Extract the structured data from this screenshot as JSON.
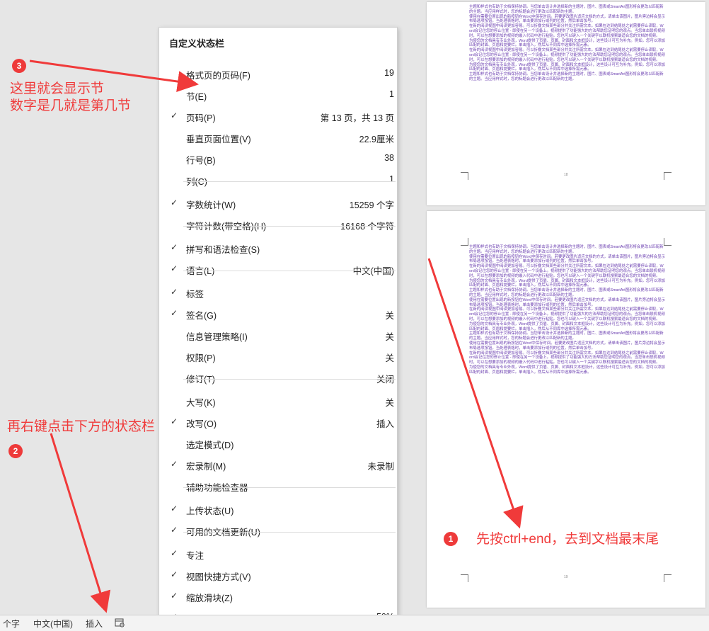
{
  "menu": {
    "title": "自定义状态栏",
    "items": [
      {
        "label": "格式页的页码(F)",
        "value": "19",
        "checked": false
      },
      {
        "label": "节(E)",
        "value": "1",
        "checked": false
      },
      {
        "label": "页码(P)",
        "value": "第 13 页，共 13 页",
        "checked": true
      },
      {
        "label": "垂直页面位置(V)",
        "value": "22.9厘米",
        "checked": false
      },
      {
        "label": "行号(B)",
        "value": "38",
        "checked": false
      },
      {
        "label": "列(C)",
        "value": "1",
        "checked": false
      },
      {
        "label": "字数统计(W)",
        "value": "15259 个字",
        "checked": true
      },
      {
        "label": "字符计数(带空格)(H)",
        "value": "16168 个字符",
        "checked": false
      },
      {
        "label": "拼写和语法检查(S)",
        "value": "",
        "checked": true
      },
      {
        "label": "语言(L)",
        "value": "中文(中国)",
        "checked": true
      },
      {
        "label": "标签",
        "value": "",
        "checked": true
      },
      {
        "label": "签名(G)",
        "value": "关",
        "checked": true
      },
      {
        "label": "信息管理策略(I)",
        "value": "关",
        "checked": false
      },
      {
        "label": "权限(P)",
        "value": "关",
        "checked": false
      },
      {
        "label": "修订(T)",
        "value": "关闭",
        "checked": false
      },
      {
        "label": "大写(K)",
        "value": "关",
        "checked": false
      },
      {
        "label": "改写(O)",
        "value": "插入",
        "checked": true
      },
      {
        "label": "选定模式(D)",
        "value": "",
        "checked": false
      },
      {
        "label": "宏录制(M)",
        "value": "未录制",
        "checked": true
      },
      {
        "label": "辅助功能检查器",
        "value": "",
        "checked": false
      },
      {
        "label": "上传状态(U)",
        "value": "",
        "checked": true
      },
      {
        "label": "可用的文档更新(U)",
        "value": "",
        "checked": true
      },
      {
        "label": "专注",
        "value": "",
        "checked": true
      },
      {
        "label": "视图快捷方式(V)",
        "value": "",
        "checked": true
      },
      {
        "label": "缩放滑块(Z)",
        "value": "",
        "checked": true
      },
      {
        "label": "缩放(Z)",
        "value": "50%",
        "checked": true
      }
    ]
  },
  "status_bar": {
    "word_count": "个字",
    "language": "中文(中国)",
    "mode": "插入"
  },
  "annotations": {
    "step1_number": "1",
    "step1_text": "先按ctrl+end，去到文档最末尾",
    "step2_number": "2",
    "step2_text": "再右键点击下方的状态栏",
    "step3_number": "3",
    "step3_line1": "这里就会显示节",
    "step3_line2": "数字是几就是第几节"
  },
  "document": {
    "page_top_number": "18",
    "page_bottom_number": "19",
    "page_top_paragraphs": [
      "主题和样式也有助于文档保持协调。当您单击设计并选择新的主题时，图片、图表或SmartArt图形将会更改以匹配新的主题。当应用样式时，您的标题会进行更改以匹配新的主题。",
      "使用在需要位置出现的新按钮在Word中保存时间。若要更改图片适应文档的方式，请单击该图片，图片旁边将会显示布局选项按钮。当处理表格时，单击要添加行或列的位置，然后单击加号。",
      "在新的阅读视图中阅读更加容易。可以折叠文档某些部分并关注所需文本。如果在达到结尾处之前需要停止读取，Word会记住您的停止位置 - 即使在另一个设备上。视频提供了功能强大的方法帮助您证明您的观点。当您单击联机视频时，可以在想要添加的视频的嵌入代码中进行粘贴。您也可以键入一个关键字以联机搜索最适合您的文档的视频。",
      "为使您的文档具有专业外观，Word提供了页眉、页脚、封面和文本框设计，这些设计可互为补充。例如，您可以添加匹配的封面、页眉和提要栏。单击插入，然后从不同库中选择所需元素。",
      "在新的阅读视图中阅读更加容易。可以折叠文档某些部分并关注所需文本。如果在达到结尾处之前需要停止读取，Word会记住您的停止位置 - 即使在另一个设备上。视频提供了功能强大的方法帮助您证明您的观点。当您单击联机视频时，可以在想要添加的视频的嵌入代码中进行粘贴。您也可以键入一个关键字以联机搜索最适合您的文档的视频。",
      "为使您的文档具有专业外观，Word提供了页眉、页脚、封面和文本框设计，这些设计可互为补充。例如，您可以添加匹配的封面、页眉和提要栏。单击插入，然后从不同库中选择所需元素。",
      "主题和样式也有助于文档保持协调。当您单击设计并选择新的主题时，图片、图表或SmartArt图形将会更改以匹配新的主题。当应用样式时，您的标题会进行更改以匹配新的主题。"
    ],
    "page_bottom_paragraphs": [
      "主题和样式也有助于文档保持协调。当您单击设计并选择新的主题时，图片、图表或SmartArt图形将会更改以匹配新的主题。当应用样式时，您的标题会进行更改以匹配新的主题。",
      "使用在需要位置出现的新按钮在Word中保存时间。若要更改图片适应文档的方式，请单击该图片，图片旁边将会显示布局选项按钮。当处理表格时，单击要添加行或列的位置，然后单击加号。",
      "在新的阅读视图中阅读更加容易。可以折叠文档某些部分并关注所需文本。如果在达到结尾处之前需要停止读取，Word会记住您的停止位置 - 即使在另一个设备上。视频提供了功能强大的方法帮助您证明您的观点。当您单击联机视频时，可以在想要添加的视频的嵌入代码中进行粘贴。您也可以键入一个关键字以联机搜索最适合您的文档的视频。",
      "为使您的文档具有专业外观，Word提供了页眉、页脚、封面和文本框设计，这些设计可互为补充。例如，您可以添加匹配的封面、页眉和提要栏。单击插入，然后从不同库中选择所需元素。",
      "主题和样式也有助于文档保持协调。当您单击设计并选择新的主题时，图片、图表或SmartArt图形将会更改以匹配新的主题。当应用样式时，您的标题会进行更改以匹配新的主题。",
      "使用在需要位置出现的新按钮在Word中保存时间。若要更改图片适应文档的方式，请单击该图片，图片旁边将会显示布局选项按钮。当处理表格时，单击要添加行或列的位置，然后单击加号。",
      "在新的阅读视图中阅读更加容易。可以折叠文档某些部分并关注所需文本。如果在达到结尾处之前需要停止读取，Word会记住您的停止位置 - 即使在另一个设备上。视频提供了功能强大的方法帮助您证明您的观点。当您单击联机视频时，可以在想要添加的视频的嵌入代码中进行粘贴。您也可以键入一个关键字以联机搜索最适合您的文档的视频。",
      "为使您的文档具有专业外观，Word提供了页眉、页脚、封面和文本框设计，这些设计可互为补充。例如，您可以添加匹配的封面、页眉和提要栏。单击插入，然后从不同库中选择所需元素。",
      "主题和样式也有助于文档保持协调。当您单击设计并选择新的主题时，图片、图表或SmartArt图形将会更改以匹配新的主题。当应用样式时，您的标题会进行更改以匹配新的主题。",
      "使用在需要位置出现的新按钮在Word中保存时间。若要更改图片适应文档的方式，请单击该图片，图片旁边将会显示布局选项按钮。当处理表格时，单击要添加行或列的位置，然后单击加号。",
      "在新的阅读视图中阅读更加容易。可以折叠文档某些部分并关注所需文本。如果在达到结尾处之前需要停止读取，Word会记住您的停止位置 - 即使在另一个设备上。视频提供了功能强大的方法帮助您证明您的观点。当您单击联机视频时，可以在想要添加的视频的嵌入代码中进行粘贴。您也可以键入一个关键字以联机搜索最适合您的文档的视频。",
      "为使您的文档具有专业外观，Word提供了页眉、页脚、封面和文本框设计，这些设计可互为补充。例如，您可以添加匹配的封面、页眉和提要栏。单击插入，然后从不同库中选择所需元素。"
    ]
  },
  "colors": {
    "annotation_red": "#f03a3a",
    "document_text": "#6b3fb0"
  },
  "icons": {
    "status_bar_macro": "macro-record-icon",
    "menu_check": "checkmark-icon"
  }
}
